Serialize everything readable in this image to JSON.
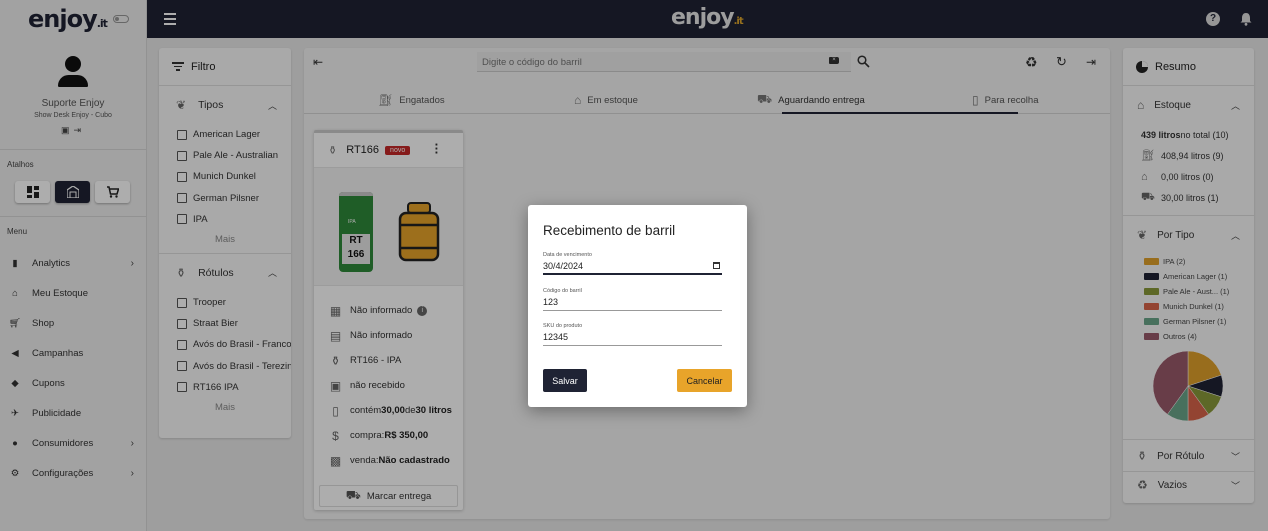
{
  "app": {
    "logo_main": "enjoy",
    "logo_suffix": ".it"
  },
  "profile": {
    "name": "Suporte Enjoy",
    "subtitle": "Show Desk Enjoy - Cubo"
  },
  "shortcuts_label": "Atalhos",
  "menu_label": "Menu",
  "menu": [
    {
      "label": "Analytics",
      "icon": "bar-chart-icon",
      "has_chevron": true
    },
    {
      "label": "Meu Estoque",
      "icon": "warehouse-icon",
      "has_chevron": false
    },
    {
      "label": "Shop",
      "icon": "cart-icon",
      "has_chevron": false
    },
    {
      "label": "Campanhas",
      "icon": "megaphone-icon",
      "has_chevron": false
    },
    {
      "label": "Cupons",
      "icon": "tag-icon",
      "has_chevron": false
    },
    {
      "label": "Publicidade",
      "icon": "rocket-icon",
      "has_chevron": false
    },
    {
      "label": "Consumidores",
      "icon": "person-icon",
      "has_chevron": true
    },
    {
      "label": "Configurações",
      "icon": "gear-icon",
      "has_chevron": true
    }
  ],
  "filter": {
    "title": "Filtro",
    "tipos": {
      "title": "Tipos",
      "items": [
        "American Lager",
        "Pale Ale - Australian",
        "Munich Dunkel",
        "German Pilsner",
        "IPA"
      ],
      "more": "Mais"
    },
    "rotulos": {
      "title": "Rótulos",
      "items": [
        "Trooper",
        "Straat Bier",
        "Avós do Brasil - Franconian",
        "Avós do Brasil - Terezinha",
        "RT166 IPA"
      ],
      "more": "Mais"
    }
  },
  "search": {
    "placeholder": "Digite o código do barril"
  },
  "tabs": [
    {
      "label": "Engatados",
      "icon": "tap-icon"
    },
    {
      "label": "Em estoque",
      "icon": "warehouse-icon"
    },
    {
      "label": "Aguardando entrega",
      "icon": "truck-icon",
      "active": true
    },
    {
      "label": "Para recolha",
      "icon": "clipboard-icon"
    }
  ],
  "card": {
    "title": "RT166",
    "badge": "novo",
    "can_ipa": "IPA",
    "can_label": "RT 166",
    "rows": [
      {
        "icon": "qr-code-icon",
        "text": "Não informado"
      },
      {
        "icon": "barcode-icon",
        "text": "Não informado"
      },
      {
        "icon": "beer-icon",
        "text": "RT166 - IPA"
      },
      {
        "icon": "calendar-icon",
        "text": "não recebido"
      },
      {
        "icon": "keg-icon",
        "prefix": "contém ",
        "bold1": "30,00",
        "mid": " de ",
        "bold2": "30 litros"
      },
      {
        "icon": "dollar-icon",
        "prefix": "compra: ",
        "bold1": "R$ 350,00"
      },
      {
        "icon": "hand-coins-icon",
        "prefix": "venda: ",
        "bold1": "Não cadastrado"
      }
    ],
    "button": "Marcar entrega"
  },
  "summary": {
    "title": "Resumo",
    "estoque": {
      "title": "Estoque",
      "total_bold": "439 litros",
      "total_rest": " no total (10)",
      "rows": [
        {
          "icon": "tap-icon",
          "text": "408,94 litros (9)"
        },
        {
          "icon": "warehouse-icon",
          "text": "0,00 litros (0)"
        },
        {
          "icon": "truck-icon",
          "text": "30,00 litros (1)"
        }
      ]
    },
    "por_tipo": {
      "title": "Por Tipo",
      "legend": [
        {
          "label": "IPA (2)",
          "color": "#e0a12c",
          "value": 2
        },
        {
          "label": "American Lager (1)",
          "color": "#1f2334",
          "value": 1
        },
        {
          "label": "Pale Ale - Aust... (1)",
          "color": "#8a9a3a",
          "value": 1
        },
        {
          "label": "Munich Dunkel (1)",
          "color": "#d9654b",
          "value": 1
        },
        {
          "label": "German Pilsner (1)",
          "color": "#6aa68a",
          "value": 1
        },
        {
          "label": "Outros (4)",
          "color": "#9a5a6a",
          "value": 4
        }
      ]
    },
    "por_rotulo": {
      "title": "Por Rótulo"
    },
    "vazios": {
      "title": "Vazios"
    }
  },
  "modal": {
    "title": "Recebimento de barril",
    "fields": [
      {
        "label": "Data de vencimento",
        "value": "30/4/2024"
      },
      {
        "label": "Código do barril",
        "value": "123"
      },
      {
        "label": "SKU do produto",
        "value": "12345"
      }
    ],
    "save": "Salvar",
    "cancel": "Cancelar"
  }
}
